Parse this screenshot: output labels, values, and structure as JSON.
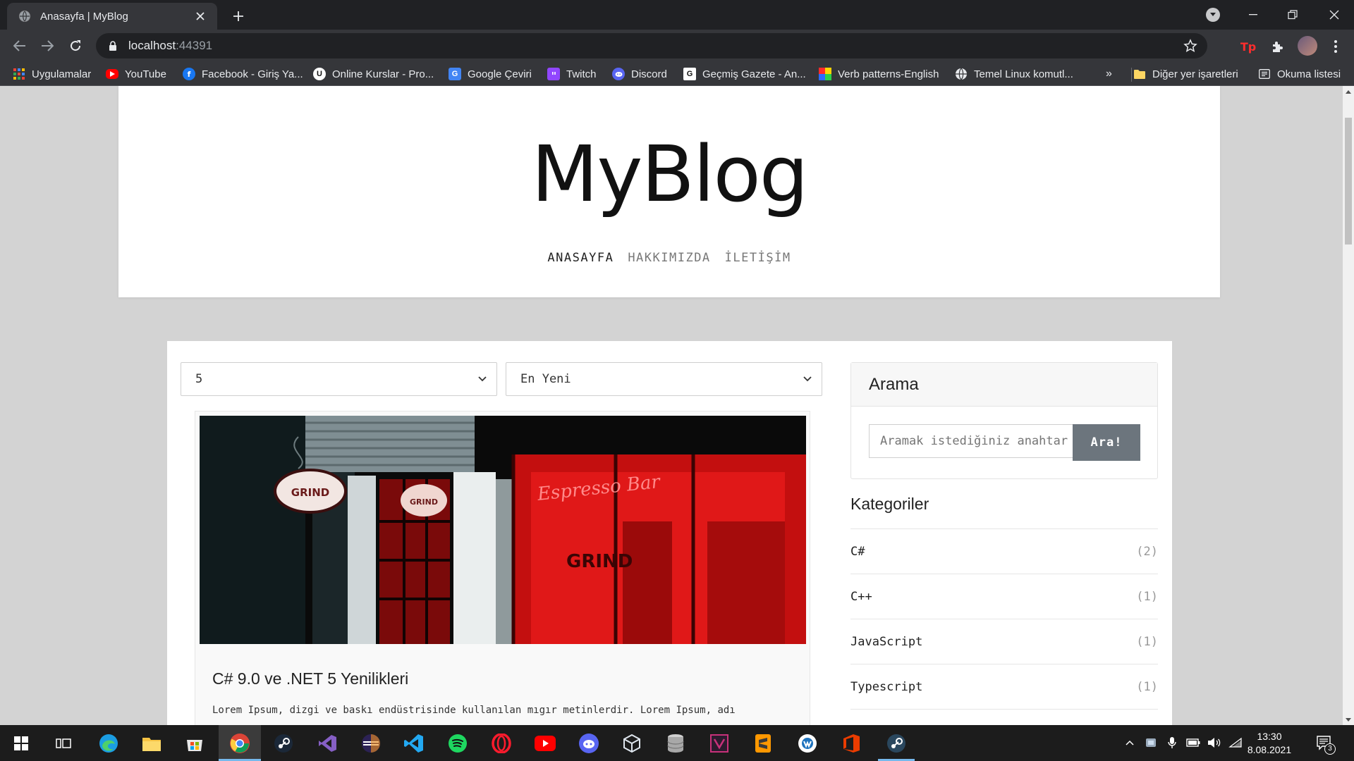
{
  "browser": {
    "tab_title": "Anasayfa | MyBlog",
    "url_host": "localhost",
    "url_port": ":44391",
    "bookmarks": [
      {
        "label": "Uygulamalar",
        "icon": "apps-grid-icon",
        "color": "#4285f4"
      },
      {
        "label": "YouTube",
        "icon": "youtube-icon",
        "color": "#ff0000"
      },
      {
        "label": "Facebook - Giriş Ya...",
        "icon": "facebook-icon",
        "color": "#1877f2"
      },
      {
        "label": "Online Kurslar - Pro...",
        "icon": "udemy-icon",
        "color": "#ffffff"
      },
      {
        "label": "Google Çeviri",
        "icon": "google-translate-icon",
        "color": "#4285f4"
      },
      {
        "label": "Twitch",
        "icon": "twitch-icon",
        "color": "#9146ff"
      },
      {
        "label": "Discord",
        "icon": "discord-icon",
        "color": "#5865f2"
      },
      {
        "label": "Geçmiş Gazete - An...",
        "icon": "newspaper-icon",
        "color": "#ffffff"
      },
      {
        "label": "Verb patterns-English",
        "icon": "colorful-squares-icon",
        "color": "#ffcc00"
      },
      {
        "label": "Temel Linux komutl...",
        "icon": "globe-icon",
        "color": "#ffffff"
      }
    ],
    "overflow_label": "»",
    "other_bookmarks": "Diğer yer işaretleri",
    "reading_list": "Okuma listesi"
  },
  "site": {
    "title": "MyBlog",
    "nav": [
      {
        "label": "ANASAYFA",
        "active": true
      },
      {
        "label": "HAKKIMIZDA",
        "active": false
      },
      {
        "label": "İLETİŞİM",
        "active": false
      }
    ]
  },
  "filters": {
    "page_size": "5",
    "sort": "En Yeni"
  },
  "post": {
    "title": "C# 9.0 ve .NET 5 Yenilikleri",
    "excerpt": "Lorem Ipsum, dizgi ve baskı endüstrisinde kullanılan mıgır metinlerdir. Lorem Ipsum, adı"
  },
  "sidebar": {
    "search": {
      "title": "Arama",
      "placeholder": "Aramak istediğiniz anahtar kelime",
      "button": "Ara!"
    },
    "categories": {
      "title": "Kategoriler",
      "items": [
        {
          "name": "C#",
          "count": "(2)"
        },
        {
          "name": "C++",
          "count": "(1)"
        },
        {
          "name": "JavaScript",
          "count": "(1)"
        },
        {
          "name": "Typescript",
          "count": "(1)"
        }
      ]
    }
  },
  "taskbar": {
    "time": "13:30",
    "date": "8.08.2021",
    "notification_count": "3"
  }
}
